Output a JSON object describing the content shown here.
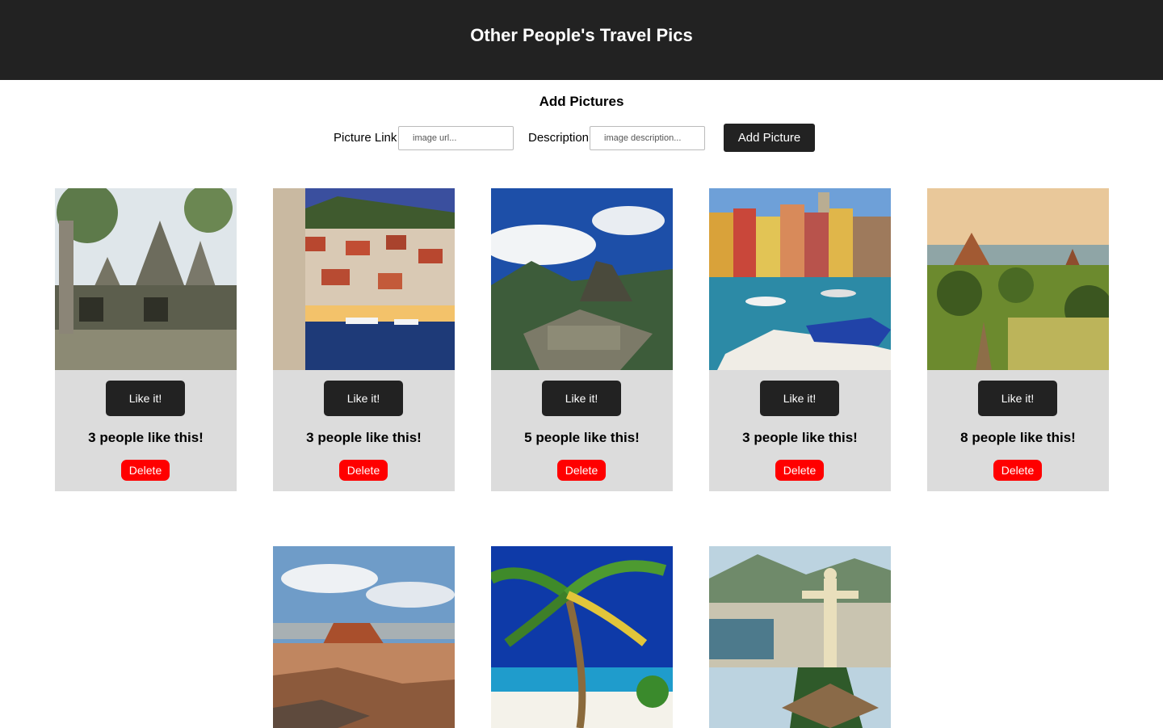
{
  "header": {
    "title": "Other People's Travel Pics"
  },
  "add_form": {
    "title": "Add Pictures",
    "link_label": "Picture Link",
    "link_placeholder": "image url...",
    "desc_label": "Description",
    "desc_placeholder": "image description...",
    "button_label": "Add Picture"
  },
  "colors": {
    "header_bg": "#222222",
    "card_bg": "#dcdcdc",
    "like_button": "#222222",
    "delete_button": "#ff0000"
  },
  "pictures": [
    {
      "scene": "jungle temple ruins",
      "like_label": "Like it!",
      "likes_text": "3 people like this!",
      "delete_label": "Delete"
    },
    {
      "scene": "coastal town harbor at dusk",
      "like_label": "Like it!",
      "likes_text": "3 people like this!",
      "delete_label": "Delete"
    },
    {
      "scene": "mountain ruins under blue sky",
      "like_label": "Like it!",
      "likes_text": "5 people like this!",
      "delete_label": "Delete"
    },
    {
      "scene": "colorful harbor with boats",
      "like_label": "Like it!",
      "likes_text": "3 people like this!",
      "delete_label": "Delete"
    },
    {
      "scene": "temples over green plain",
      "like_label": "Like it!",
      "likes_text": "8 people like this!",
      "delete_label": "Delete"
    },
    {
      "scene": "desert canyon mesa"
    },
    {
      "scene": "palm tree beach"
    },
    {
      "scene": "statue above coastal city"
    }
  ]
}
